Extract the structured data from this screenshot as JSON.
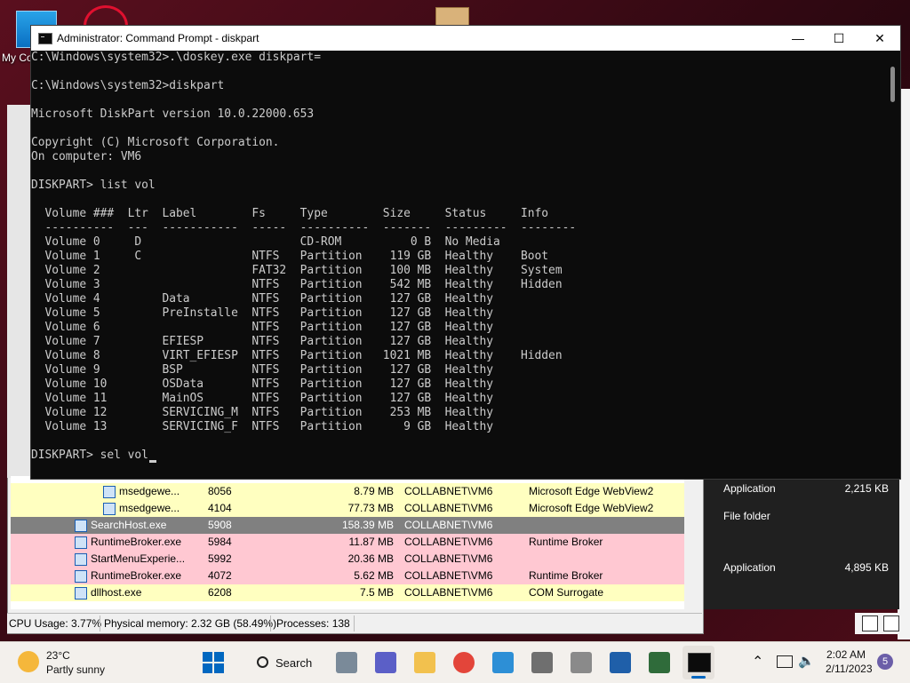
{
  "desktop": {
    "icon_label": "My Co"
  },
  "cmd": {
    "title": "Administrator:  Command Prompt - diskpart",
    "minimize": "—",
    "maximize": "☐",
    "close": "✕",
    "lines": [
      "C:\\Windows\\system32>.\\doskey.exe diskpart=",
      "",
      "C:\\Windows\\system32>diskpart",
      "",
      "Microsoft DiskPart version 10.0.22000.653",
      "",
      "Copyright (C) Microsoft Corporation.",
      "On computer: VM6",
      "",
      "DISKPART> list vol",
      "",
      "  Volume ###  Ltr  Label        Fs     Type        Size     Status     Info",
      "  ----------  ---  -----------  -----  ----------  -------  ---------  --------",
      "  Volume 0     D                       CD-ROM          0 B  No Media",
      "  Volume 1     C                NTFS   Partition    119 GB  Healthy    Boot",
      "  Volume 2                      FAT32  Partition    100 MB  Healthy    System",
      "  Volume 3                      NTFS   Partition    542 MB  Healthy    Hidden",
      "  Volume 4         Data         NTFS   Partition    127 GB  Healthy",
      "  Volume 5         PreInstalle  NTFS   Partition    127 GB  Healthy",
      "  Volume 6                      NTFS   Partition    127 GB  Healthy",
      "  Volume 7         EFIESP       NTFS   Partition    127 GB  Healthy",
      "  Volume 8         VIRT_EFIESP  NTFS   Partition   1021 MB  Healthy    Hidden",
      "  Volume 9         BSP          NTFS   Partition    127 GB  Healthy",
      "  Volume 10        OSData       NTFS   Partition    127 GB  Healthy",
      "  Volume 11        MainOS       NTFS   Partition    127 GB  Healthy",
      "  Volume 12        SERVICING_M  NTFS   Partition    253 MB  Healthy",
      "  Volume 13        SERVICING_F  NTFS   Partition      9 GB  Healthy",
      "",
      "DISKPART> sel vol"
    ]
  },
  "procexp": {
    "rows": [
      {
        "name": "msedgewe...",
        "pid": "8056",
        "mem": "8.79 MB",
        "user": "COLLABNET\\VM6",
        "desc": "Microsoft Edge WebView2",
        "bg": "#ffffc0",
        "indent": 2
      },
      {
        "name": "msedgewe...",
        "pid": "4104",
        "mem": "77.73 MB",
        "user": "COLLABNET\\VM6",
        "desc": "Microsoft Edge WebView2",
        "bg": "#ffffc0",
        "indent": 2
      },
      {
        "name": "SearchHost.exe",
        "pid": "5908",
        "mem": "158.39 MB",
        "user": "COLLABNET\\VM6",
        "desc": "",
        "bg": "#808080",
        "indent": 1
      },
      {
        "name": "RuntimeBroker.exe",
        "pid": "5984",
        "mem": "11.87 MB",
        "user": "COLLABNET\\VM6",
        "desc": "Runtime Broker",
        "bg": "#ffc8d2",
        "indent": 1
      },
      {
        "name": "StartMenuExperie...",
        "pid": "5992",
        "mem": "20.36 MB",
        "user": "COLLABNET\\VM6",
        "desc": "",
        "bg": "#ffc8d2",
        "indent": 1
      },
      {
        "name": "RuntimeBroker.exe",
        "pid": "4072",
        "mem": "5.62 MB",
        "user": "COLLABNET\\VM6",
        "desc": "Runtime Broker",
        "bg": "#ffc8d2",
        "indent": 1
      },
      {
        "name": "dllhost.exe",
        "pid": "6208",
        "mem": "7.5 MB",
        "user": "COLLABNET\\VM6",
        "desc": "COM Surrogate",
        "bg": "#ffffc0",
        "indent": 1
      }
    ],
    "status": {
      "cpu": "CPU Usage: 3.77%",
      "memory": "Physical memory: 2.32 GB (58.49%)",
      "processes": "Processes: 138"
    }
  },
  "explorer": {
    "items": [
      {
        "type": "Application",
        "size": "2,215 KB"
      },
      {
        "type": "File folder",
        "size": ""
      },
      {
        "type": "Application",
        "size": "4,895 KB"
      }
    ]
  },
  "taskbar": {
    "weather_temp": "23°C",
    "weather_desc": "Partly sunny",
    "search_label": "Search",
    "time": "2:02 AM",
    "date": "2/11/2023",
    "notification_count": "5"
  }
}
